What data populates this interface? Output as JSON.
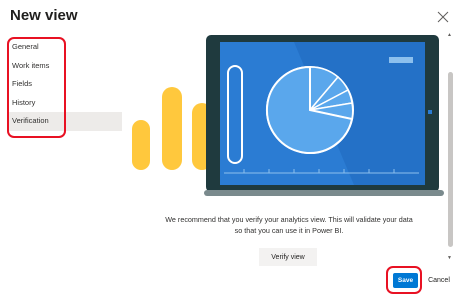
{
  "dialog": {
    "title": "New view",
    "close_icon": "close-icon"
  },
  "nav": {
    "items": [
      {
        "label": "General",
        "selected": false
      },
      {
        "label": "Work items",
        "selected": false
      },
      {
        "label": "Fields",
        "selected": false
      },
      {
        "label": "History",
        "selected": false
      },
      {
        "label": "Verification",
        "selected": true
      }
    ]
  },
  "main": {
    "message": "We recommend that you verify your analytics view. This will validate your data so that you can use it in Power BI.",
    "verify_label": "Verify view"
  },
  "footer": {
    "save_label": "Save",
    "cancel_label": "Cancel"
  },
  "colors": {
    "accent": "#0078d4",
    "highlight": "#e81123",
    "bars": "#ffc83d",
    "tablet_frame": "#1f3a3e",
    "screen": "#2b7cd3"
  }
}
